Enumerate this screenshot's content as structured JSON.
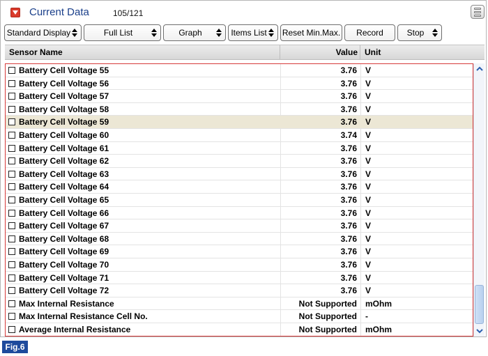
{
  "window": {
    "title": "Current Data",
    "count": "105/121"
  },
  "toolbar": [
    {
      "label": "Standard Display",
      "has_arrow": true
    },
    {
      "label": "Full List",
      "has_arrow": true
    },
    {
      "label": "Graph",
      "has_arrow": true
    },
    {
      "label": "Items List",
      "has_arrow": true
    },
    {
      "label": "Reset Min.Max.",
      "has_arrow": false
    },
    {
      "label": "Record",
      "has_arrow": false
    },
    {
      "label": "Stop",
      "has_arrow": true
    }
  ],
  "table": {
    "headers": {
      "name": "Sensor Name",
      "value": "Value",
      "unit": "Unit"
    },
    "rows": [
      {
        "name": "Battery Cell Voltage 55",
        "value": "3.76",
        "unit": "V",
        "highlighted": false
      },
      {
        "name": "Battery Cell Voltage 56",
        "value": "3.76",
        "unit": "V",
        "highlighted": false
      },
      {
        "name": "Battery Cell Voltage 57",
        "value": "3.76",
        "unit": "V",
        "highlighted": false
      },
      {
        "name": "Battery Cell Voltage 58",
        "value": "3.76",
        "unit": "V",
        "highlighted": false
      },
      {
        "name": "Battery Cell Voltage 59",
        "value": "3.76",
        "unit": "V",
        "highlighted": true
      },
      {
        "name": "Battery Cell Voltage 60",
        "value": "3.74",
        "unit": "V",
        "highlighted": false
      },
      {
        "name": "Battery Cell Voltage 61",
        "value": "3.76",
        "unit": "V",
        "highlighted": false
      },
      {
        "name": "Battery Cell Voltage 62",
        "value": "3.76",
        "unit": "V",
        "highlighted": false
      },
      {
        "name": "Battery Cell Voltage 63",
        "value": "3.76",
        "unit": "V",
        "highlighted": false
      },
      {
        "name": "Battery Cell Voltage 64",
        "value": "3.76",
        "unit": "V",
        "highlighted": false
      },
      {
        "name": "Battery Cell Voltage 65",
        "value": "3.76",
        "unit": "V",
        "highlighted": false
      },
      {
        "name": "Battery Cell Voltage 66",
        "value": "3.76",
        "unit": "V",
        "highlighted": false
      },
      {
        "name": "Battery Cell Voltage 67",
        "value": "3.76",
        "unit": "V",
        "highlighted": false
      },
      {
        "name": "Battery Cell Voltage 68",
        "value": "3.76",
        "unit": "V",
        "highlighted": false
      },
      {
        "name": "Battery Cell Voltage 69",
        "value": "3.76",
        "unit": "V",
        "highlighted": false
      },
      {
        "name": "Battery Cell Voltage 70",
        "value": "3.76",
        "unit": "V",
        "highlighted": false
      },
      {
        "name": "Battery Cell Voltage 71",
        "value": "3.76",
        "unit": "V",
        "highlighted": false
      },
      {
        "name": "Battery Cell Voltage 72",
        "value": "3.76",
        "unit": "V",
        "highlighted": false
      },
      {
        "name": "Max Internal Resistance",
        "value": "Not Supported",
        "unit": "mOhm",
        "highlighted": false
      },
      {
        "name": "Max Internal Resistance Cell No.",
        "value": "Not Supported",
        "unit": "-",
        "highlighted": false
      },
      {
        "name": "Average Internal Resistance",
        "value": "Not Supported",
        "unit": "mOhm",
        "highlighted": false
      }
    ]
  },
  "figure_label": "Fig.6",
  "colors": {
    "title": "#1a3f8a",
    "collapse": "#d93a2b",
    "highlight_row": "#ece7d5",
    "selection_border": "#d63a3a",
    "figure_badge": "#1e4a9c"
  },
  "icons": {
    "collapse": "chevron-down-icon",
    "menu": "menu-icon",
    "scroll_up": "scroll-up-arrow-icon",
    "scroll_down": "scroll-down-arrow-icon"
  }
}
